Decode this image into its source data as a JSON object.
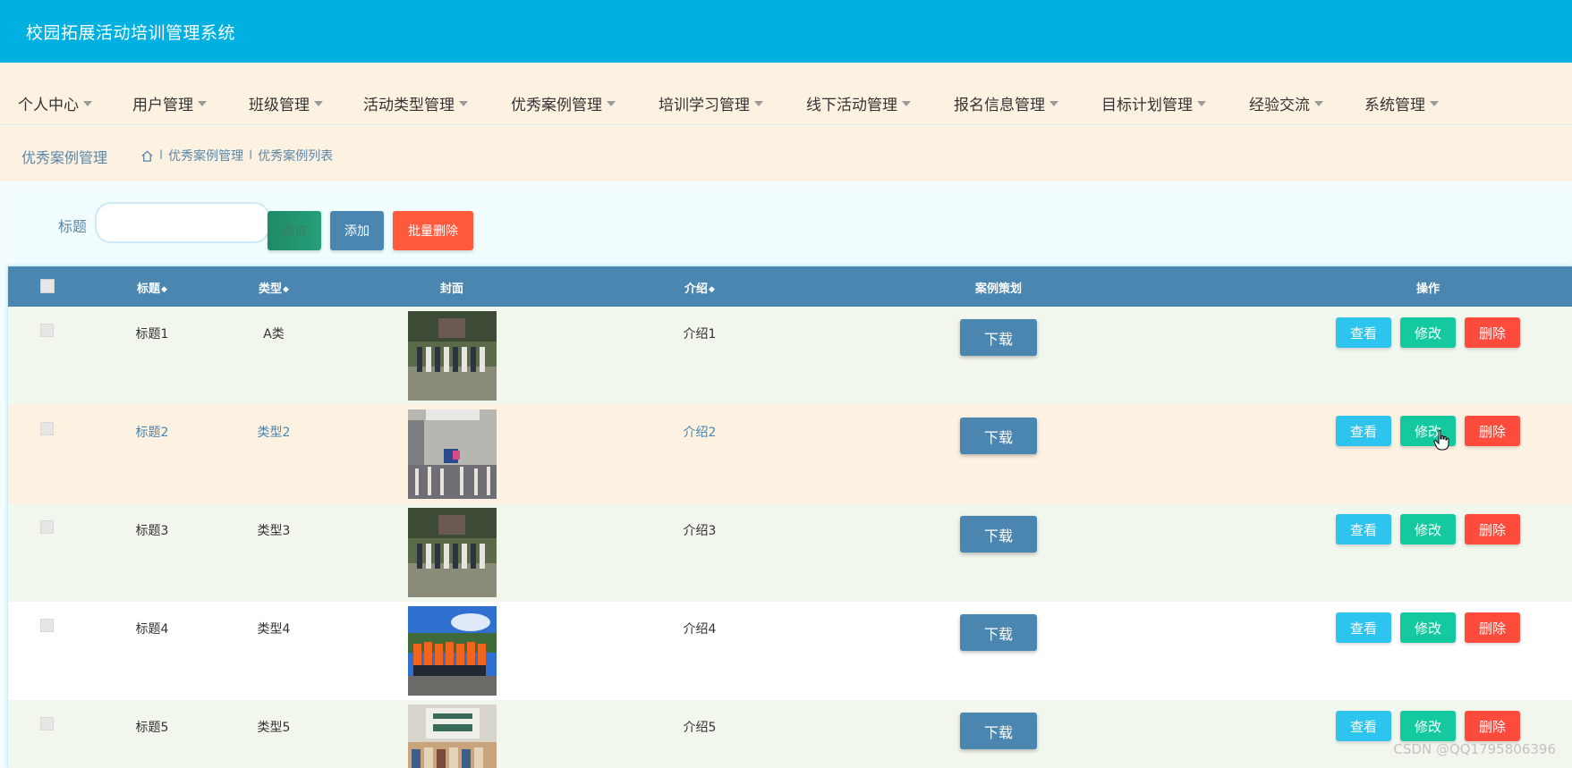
{
  "app": {
    "title": "校园拓展活动培训管理系统"
  },
  "nav": {
    "items": [
      {
        "label": "个人中心"
      },
      {
        "label": "用户管理"
      },
      {
        "label": "班级管理"
      },
      {
        "label": "活动类型管理"
      },
      {
        "label": "优秀案例管理"
      },
      {
        "label": "培训学习管理"
      },
      {
        "label": "线下活动管理"
      },
      {
        "label": "报名信息管理"
      },
      {
        "label": "目标计划管理"
      },
      {
        "label": "经验交流"
      },
      {
        "label": "系统管理"
      }
    ]
  },
  "breadcrumb": {
    "page_title": "优秀案例管理",
    "separator": "I",
    "items": [
      "优秀案例管理",
      "优秀案例列表"
    ]
  },
  "search": {
    "label": "标题",
    "value": "",
    "placeholder": "",
    "query_label": "查询",
    "add_label": "添加",
    "batch_delete_label": "批量删除"
  },
  "table": {
    "columns": {
      "title": "标题",
      "type": "类型",
      "cover": "封面",
      "intro": "介绍",
      "plan": "案例策划",
      "actions": "操作"
    },
    "sort_glyph": "◆",
    "rows": [
      {
        "title": "标题1",
        "type": "A类",
        "intro": "介绍1"
      },
      {
        "title": "标题2",
        "type": "类型2",
        "intro": "介绍2"
      },
      {
        "title": "标题3",
        "type": "类型3",
        "intro": "介绍3"
      },
      {
        "title": "标题4",
        "type": "类型4",
        "intro": "介绍4"
      },
      {
        "title": "标题5",
        "type": "类型5",
        "intro": "介绍5"
      }
    ],
    "download_label": "下载",
    "view_label": "查看",
    "edit_label": "修改",
    "delete_label": "删除"
  },
  "watermark": "CSDN @QQ1795806396",
  "colors": {
    "topbar": "#00b0e0",
    "nav_bg": "#fdf1e2",
    "table_header": "#4a86b0",
    "view_btn": "#2ec4f0",
    "edit_btn": "#14c9a0",
    "delete_btn": "#ff4b3c",
    "batch_delete_btn": "#ff5a3c",
    "row_even": "#f2f7ee",
    "row_odd_highlight": "#fdf1e2"
  },
  "icons": {
    "breadcrumb_home": "home-icon",
    "nav_caret": "chevron-down-icon",
    "cursor": "hand-pointer-icon"
  }
}
